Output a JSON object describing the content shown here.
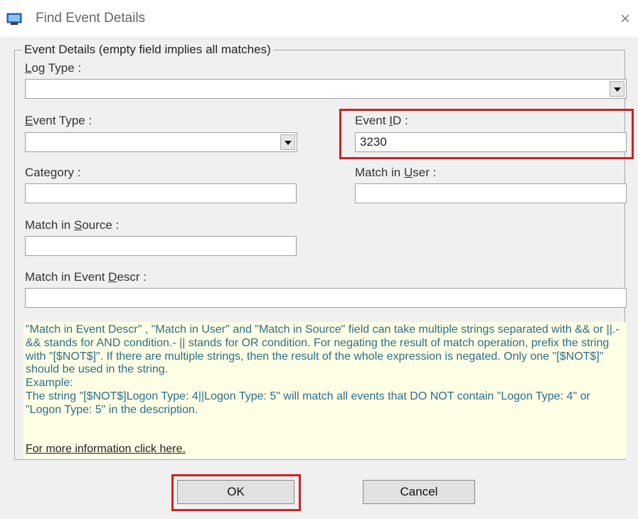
{
  "window": {
    "title": "Find Event Details",
    "close_icon": "×"
  },
  "group": {
    "legend": "Event Details (empty field implies all matches)"
  },
  "fields": {
    "log_type": {
      "label_pre": "",
      "label_acc": "L",
      "label_post": "og Type :",
      "value": ""
    },
    "event_type": {
      "label_pre": "",
      "label_acc": "E",
      "label_post": "vent Type :",
      "value": ""
    },
    "event_id": {
      "label_pre": "Event ",
      "label_acc": "I",
      "label_post": "D :",
      "value": "3230"
    },
    "category": {
      "label": "Category :",
      "value": ""
    },
    "match_user": {
      "label_pre": "Match in ",
      "label_acc": "U",
      "label_post": "ser :",
      "value": ""
    },
    "match_source": {
      "label_pre": "Match in ",
      "label_acc": "S",
      "label_post": "ource :",
      "value": ""
    },
    "match_descr": {
      "label_pre": "Match in Event ",
      "label_acc": "D",
      "label_post": "escr :",
      "value": ""
    }
  },
  "help": {
    "text": "\"Match in Event Descr\" , \"Match in User\" and \"Match in Source\" field can take multiple strings separated with && or ||.- && stands for AND condition.- || stands for OR condition. For negating the result of match operation, prefix the string with \"[$NOT$]\". If there are multiple strings, then the result of the whole expression is negated. Only one \"[$NOT$]\" should be used in the string.\nExample:\nThe string \"[$NOT$]Logon Type: 4||Logon Type: 5\" will match all events that DO NOT contain \"Logon Type: 4\" or \"Logon Type: 5\" in the description.",
    "link": "For more information click here."
  },
  "buttons": {
    "ok": "OK",
    "cancel": "Cancel"
  },
  "colors": {
    "highlight": "#d21f1f",
    "help_bg": "#ffffe5",
    "help_text": "#2a6e8a"
  }
}
